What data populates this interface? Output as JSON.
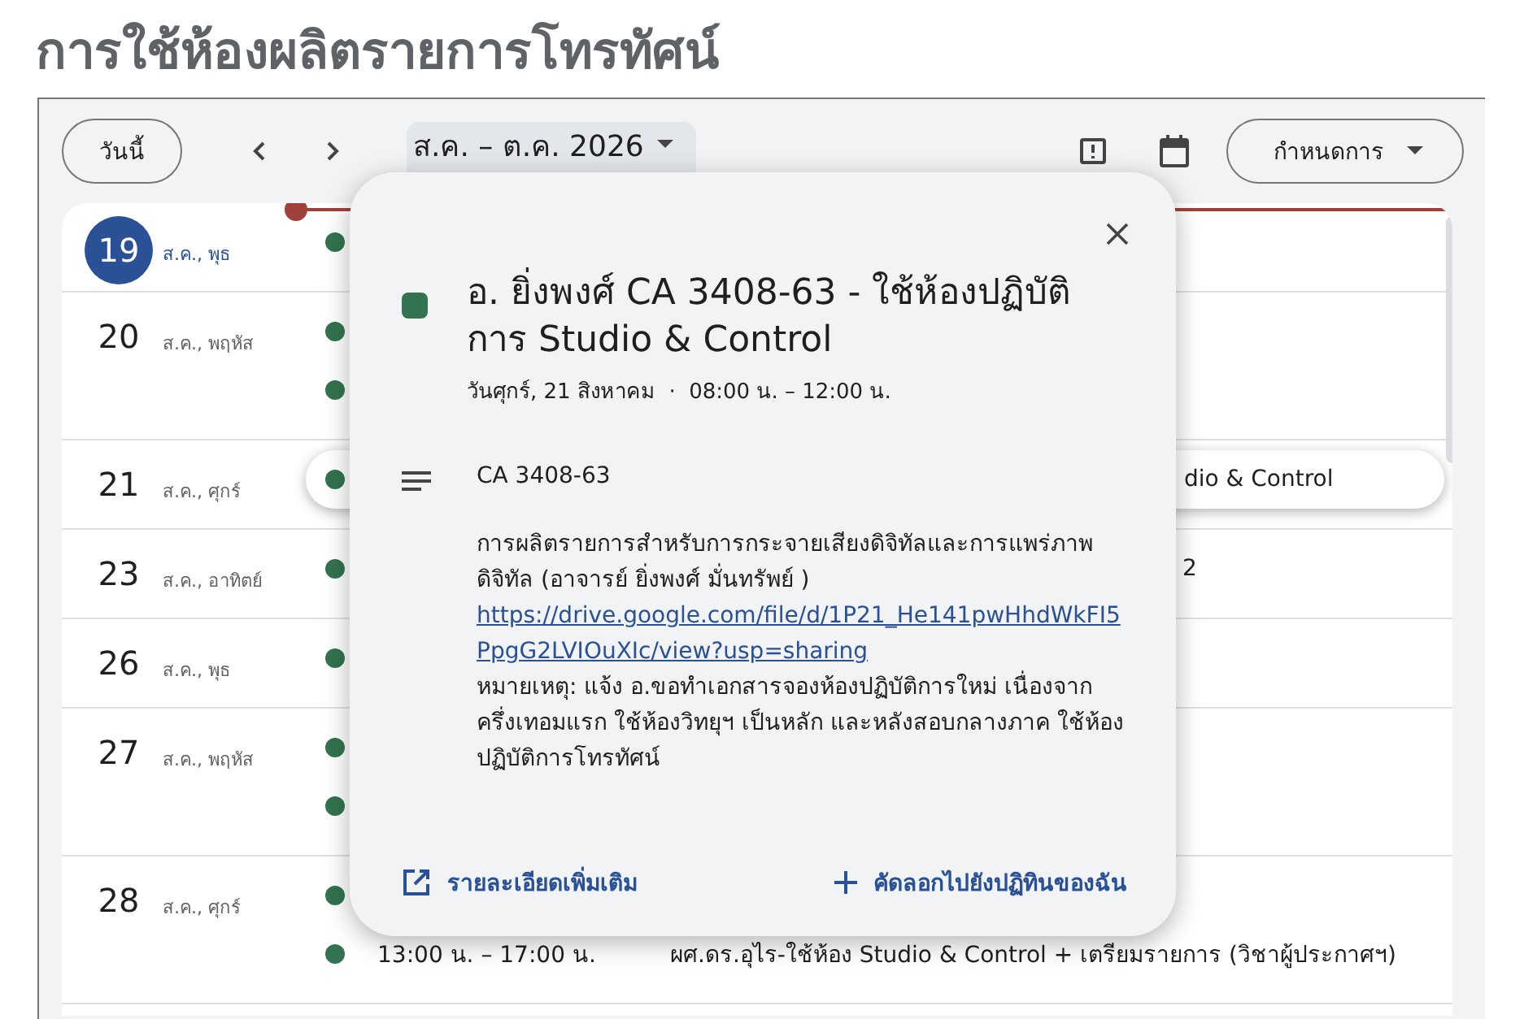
{
  "page_title": "การใช้ห้องผลิตรายการโทรทัศน์",
  "toolbar": {
    "today_button": "วันนี้",
    "date_range": "ส.ค. – ต.ค. 2026",
    "view_button": "กำหนดการ"
  },
  "days": [
    {
      "day": "19",
      "label": "ส.ค., พุธ",
      "today": true,
      "events": [
        {
          "kind": "covered",
          "selected": false
        }
      ]
    },
    {
      "day": "20",
      "label": "ส.ค., พฤหัส",
      "today": false,
      "events": [
        {
          "kind": "covered",
          "selected": false
        },
        {
          "kind": "covered",
          "selected": false
        }
      ]
    },
    {
      "day": "21",
      "label": "ส.ค., ศุกร์",
      "today": false,
      "events": [
        {
          "kind": "covered",
          "text": "dio & Control",
          "selected": true
        }
      ]
    },
    {
      "day": "23",
      "label": "ส.ค., อาทิตย์",
      "today": false,
      "events": [
        {
          "kind": "covered",
          "text": "2",
          "selected": false
        }
      ]
    },
    {
      "day": "26",
      "label": "ส.ค., พุธ",
      "today": false,
      "events": [
        {
          "kind": "covered",
          "selected": false
        }
      ]
    },
    {
      "day": "27",
      "label": "ส.ค., พฤหัส",
      "today": false,
      "events": [
        {
          "kind": "covered",
          "selected": false
        },
        {
          "kind": "covered",
          "selected": false
        }
      ]
    },
    {
      "day": "28",
      "label": "ส.ค., ศุกร์",
      "today": false,
      "events": [
        {
          "kind": "covered",
          "selected": false
        },
        {
          "kind": "full",
          "time": "13:00 น. – 17:00 น.",
          "text": "ผศ.ดร.อุไร-ใช้ห้อง Studio & Control + เตรียมรายการ (วิชาผู้ประกาศฯ)",
          "selected": false
        }
      ]
    }
  ],
  "popup": {
    "color": "#33734f",
    "title": "อ. ยิ่งพงศ์ CA 3408-63 - ใช้ห้องปฏิบัติการ Studio & Control",
    "when": "วันศุกร์, 21 สิงหาคม  ·  08:00 น. – 12:00 น.",
    "code": "CA 3408-63",
    "description": [
      {
        "kind": "text",
        "text": "การผลิตรายการสำหรับการกระจายเสียงดิจิทัลและการแพร่ภาพดิจิทัล (อาจารย์ ยิ่งพงศ์ มั่นทรัพย์ )"
      },
      {
        "kind": "link",
        "text": "https://drive.google.com/file/d/1P21_He141pwHhdWkFI5PpgG2LVIOuXIc/view?usp=sharing"
      },
      {
        "kind": "text",
        "text": "หมายเหตุ: แจ้ง อ.ขอทำเอกสารจองห้องปฏิบัติการใหม่ เนื่องจาก ครึ่งเทอมแรก ใช้ห้องวิทยุฯ เป็นหลัก และหลังสอบกลางภาค ใช้ห้องปฏิบัติการโทรทัศน์"
      }
    ],
    "more_link": "รายละเอียดเพิ่มเติม",
    "copy_link": "คัดลอกไปยังปฏิทินของฉัน"
  }
}
